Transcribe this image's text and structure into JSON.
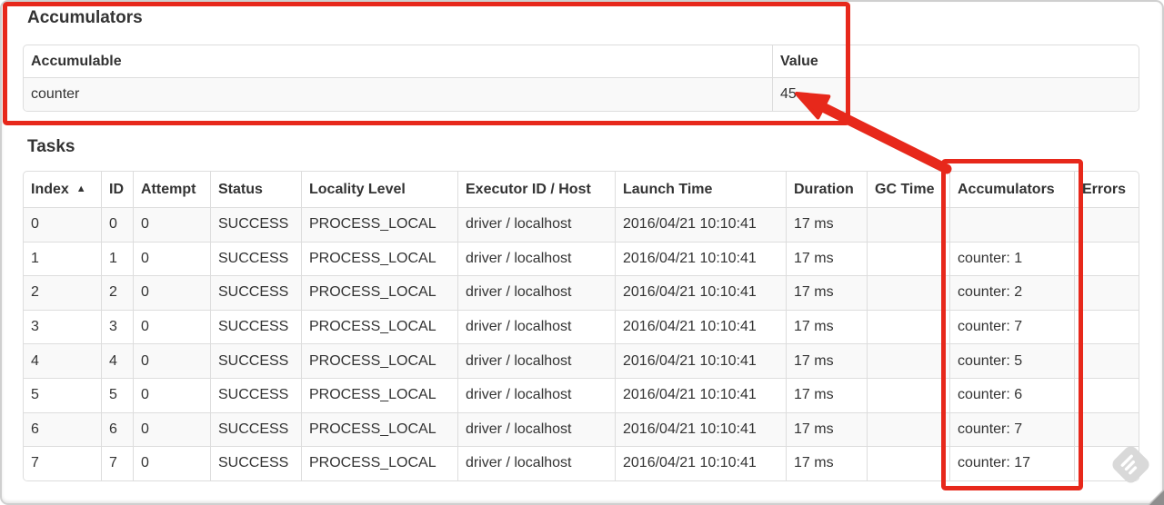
{
  "accumulators_section": {
    "title": "Accumulators",
    "table": {
      "headers": [
        "Accumulable",
        "Value"
      ],
      "rows": [
        [
          "counter",
          "45"
        ]
      ]
    }
  },
  "tasks_section": {
    "title": "Tasks",
    "table": {
      "headers": [
        "Index",
        "ID",
        "Attempt",
        "Status",
        "Locality Level",
        "Executor ID / Host",
        "Launch Time",
        "Duration",
        "GC Time",
        "Accumulators",
        "Errors"
      ],
      "sort_column": 0,
      "sort_icon": "▲",
      "rows": [
        [
          "0",
          "0",
          "0",
          "SUCCESS",
          "PROCESS_LOCAL",
          "driver / localhost",
          "2016/04/21 10:10:41",
          "17 ms",
          "",
          "",
          ""
        ],
        [
          "1",
          "1",
          "0",
          "SUCCESS",
          "PROCESS_LOCAL",
          "driver / localhost",
          "2016/04/21 10:10:41",
          "17 ms",
          "",
          "counter: 1",
          ""
        ],
        [
          "2",
          "2",
          "0",
          "SUCCESS",
          "PROCESS_LOCAL",
          "driver / localhost",
          "2016/04/21 10:10:41",
          "17 ms",
          "",
          "counter: 2",
          ""
        ],
        [
          "3",
          "3",
          "0",
          "SUCCESS",
          "PROCESS_LOCAL",
          "driver / localhost",
          "2016/04/21 10:10:41",
          "17 ms",
          "",
          "counter: 7",
          ""
        ],
        [
          "4",
          "4",
          "0",
          "SUCCESS",
          "PROCESS_LOCAL",
          "driver / localhost",
          "2016/04/21 10:10:41",
          "17 ms",
          "",
          "counter: 5",
          ""
        ],
        [
          "5",
          "5",
          "0",
          "SUCCESS",
          "PROCESS_LOCAL",
          "driver / localhost",
          "2016/04/21 10:10:41",
          "17 ms",
          "",
          "counter: 6",
          ""
        ],
        [
          "6",
          "6",
          "0",
          "SUCCESS",
          "PROCESS_LOCAL",
          "driver / localhost",
          "2016/04/21 10:10:41",
          "17 ms",
          "",
          "counter: 7",
          ""
        ],
        [
          "7",
          "7",
          "0",
          "SUCCESS",
          "PROCESS_LOCAL",
          "driver / localhost",
          "2016/04/21 10:10:41",
          "17 ms",
          "",
          "counter: 17",
          ""
        ]
      ]
    }
  },
  "annotations": {
    "color": "#e7281b"
  }
}
